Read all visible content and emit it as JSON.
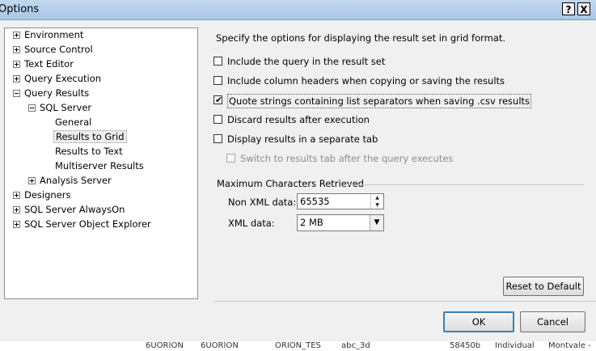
{
  "window": {
    "title": "Options",
    "help_label": "?",
    "close_label": "X"
  },
  "tree": {
    "environment": "Environment",
    "source_control": "Source Control",
    "text_editor": "Text Editor",
    "query_execution": "Query Execution",
    "query_results": "Query Results",
    "sql_server": "SQL Server",
    "general": "General",
    "results_to_grid": "Results to Grid",
    "results_to_text": "Results to Text",
    "multiserver_results": "Multiserver Results",
    "analysis_server": "Analysis Server",
    "designers": "Designers",
    "sql_server_alwayson": "SQL Server AlwaysOn",
    "sql_server_object_explorer": "SQL Server Object Explorer",
    "selected": "Results to Grid"
  },
  "panel": {
    "heading": "Specify the options for displaying the result set in grid format.",
    "options": [
      {
        "label": "Include the query in the result set",
        "checked": false,
        "enabled": true
      },
      {
        "label": "Include column headers when copying or saving the results",
        "checked": false,
        "enabled": true
      },
      {
        "label": "Quote strings containing list separators when saving .csv results",
        "checked": true,
        "enabled": true
      },
      {
        "label": "Discard results after execution",
        "checked": false,
        "enabled": true
      },
      {
        "label": "Display results in a separate tab",
        "checked": false,
        "enabled": true
      },
      {
        "label": "Switch to results tab after the query executes",
        "checked": false,
        "enabled": false
      }
    ],
    "max_chars_group": "Maximum Characters Retrieved",
    "non_xml_label": "Non XML data:",
    "non_xml_value": "65535",
    "xml_label": "XML data:",
    "xml_value": "2 MB",
    "reset_label": "Reset to Default"
  },
  "footer": {
    "ok_label": "OK",
    "cancel_label": "Cancel"
  },
  "background_grid": [
    "6UORION",
    "6UORION",
    "ORION_TES",
    "abc_3d",
    "58450b",
    "Individual",
    "Montvale -"
  ]
}
